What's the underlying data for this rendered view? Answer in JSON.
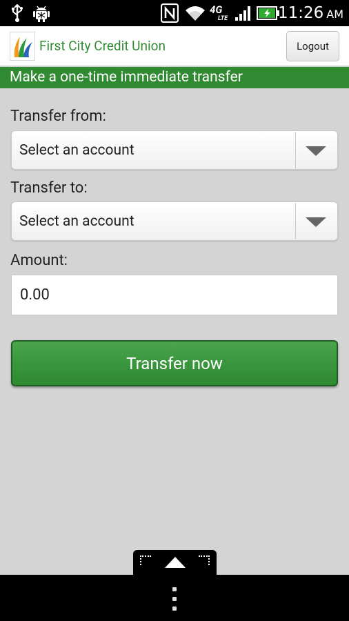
{
  "status_bar": {
    "time": "11:26",
    "ampm": "AM",
    "network": "4G",
    "network_sub": "LTE",
    "icons": [
      "usb-icon",
      "android-debug-icon",
      "nfc-icon",
      "wifi-icon",
      "network-4g-lte-icon",
      "signal-icon",
      "battery-charging-icon"
    ]
  },
  "app": {
    "title": "First City Credit Union",
    "logout_label": "Logout",
    "brand_color": "#2f8a32"
  },
  "page": {
    "subtitle": "Make a one-time immediate transfer"
  },
  "form": {
    "from_label": "Transfer from:",
    "from_value": "Select an account",
    "to_label": "Transfer to:",
    "to_value": "Select an account",
    "amount_label": "Amount:",
    "amount_value": "0.00",
    "submit_label": "Transfer now"
  },
  "nav": {
    "handle_icon": "expand-up-icon",
    "menu_icon": "overflow-menu-icon"
  }
}
